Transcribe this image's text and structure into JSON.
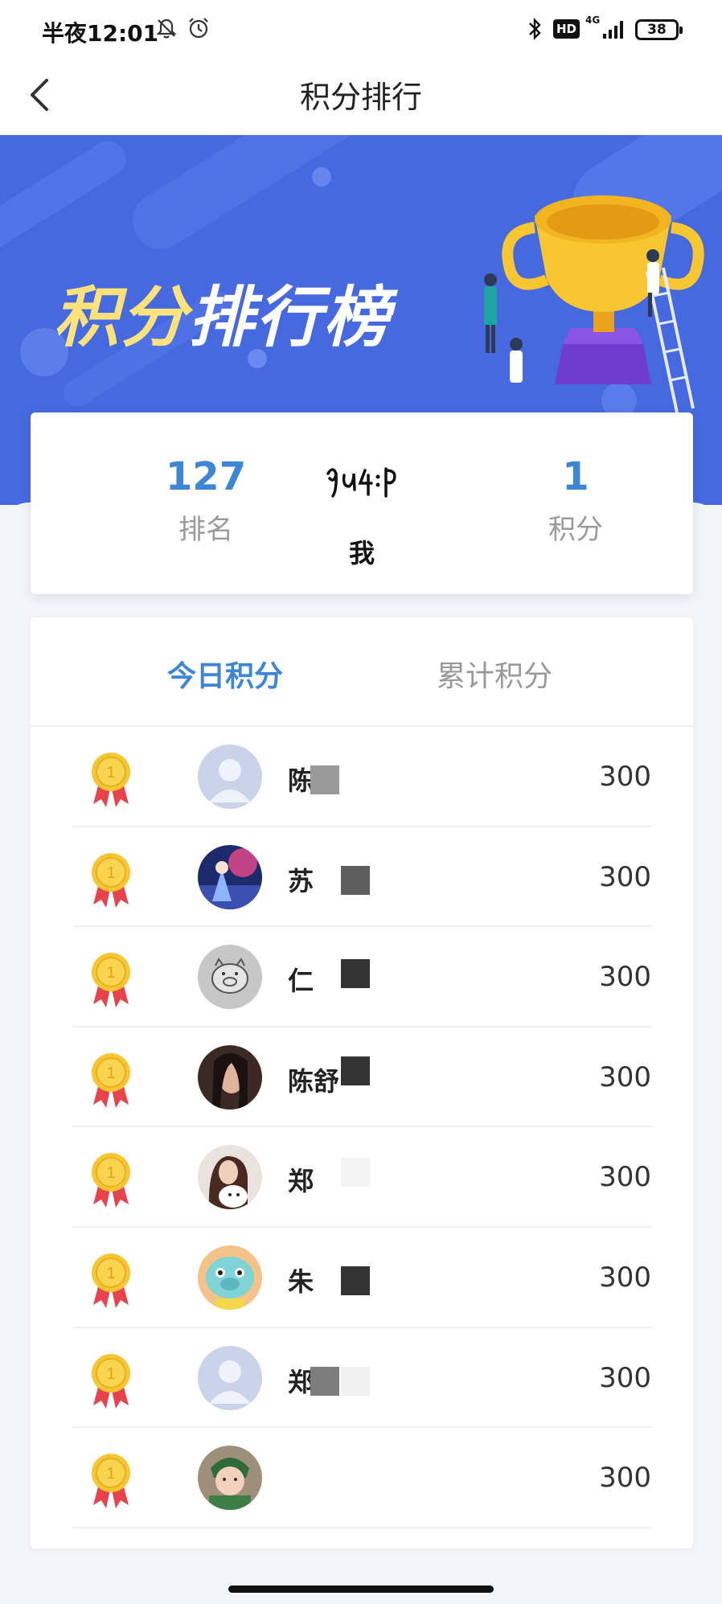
{
  "status_bar": {
    "time": "半夜12:01",
    "network_label": "4G",
    "hd_label": "HD",
    "battery": "38"
  },
  "nav": {
    "title": "积分排行"
  },
  "banner": {
    "title_part1": "积分",
    "title_part2": "排行榜"
  },
  "my_stats": {
    "rank_value": "127",
    "rank_label": "排名",
    "name": "我",
    "score_value": "1",
    "score_label": "积分"
  },
  "tabs": {
    "today": "今日积分",
    "total": "累计积分",
    "active": "today"
  },
  "ranking": [
    {
      "name": "陈",
      "score": "300",
      "avatar": "default-avatar"
    },
    {
      "name": "苏",
      "score": "300",
      "avatar": "anime-avatar"
    },
    {
      "name": "仁",
      "score": "300",
      "avatar": "pig-sketch-avatar"
    },
    {
      "name": "陈舒",
      "score": "300",
      "avatar": "portrait-avatar"
    },
    {
      "name": "郑",
      "score": "300",
      "avatar": "girl-dog-avatar"
    },
    {
      "name": "朱",
      "score": "300",
      "avatar": "cartoon-pig-avatar"
    },
    {
      "name": "郑",
      "score": "300",
      "avatar": "default-avatar"
    },
    {
      "name": "",
      "score": "300",
      "avatar": "baby-avatar"
    }
  ],
  "colors": {
    "accent": "#3d86d6",
    "banner": "#4669e0",
    "title_yellow": "#fbe27a",
    "medal_gold": "#f7c631",
    "medal_ribbon": "#e8424c"
  }
}
